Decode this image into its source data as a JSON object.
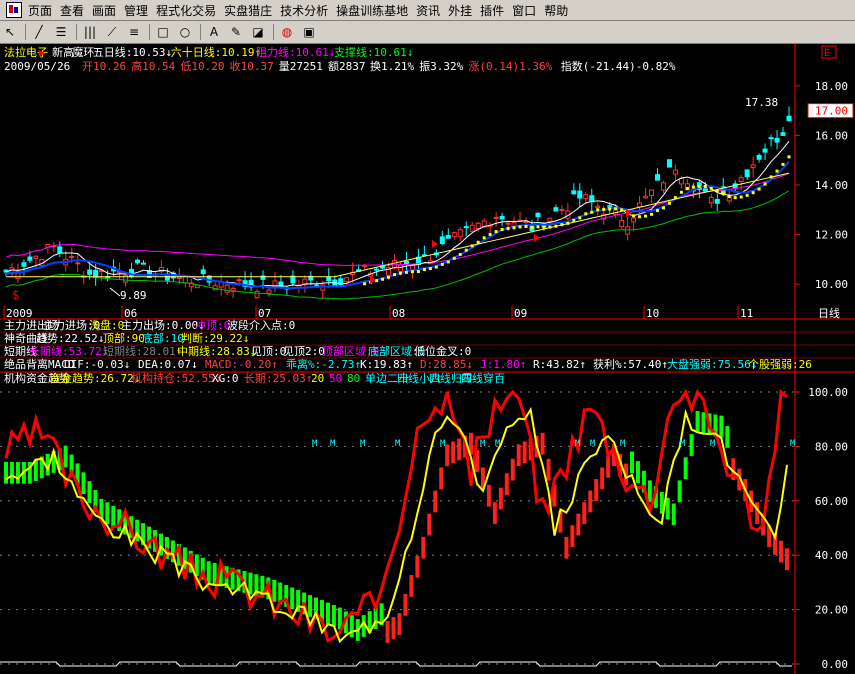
{
  "menu": [
    "页面",
    "查看",
    "画面",
    "管理",
    "程式化交易",
    "实盘猎庄",
    "技术分析",
    "操盘训练基地",
    "资讯",
    "外挂",
    "插件",
    "窗口",
    "帮助"
  ],
  "toolbar_icons": [
    "cursor-icon",
    "line-icon",
    "indicator-icon",
    "grid-icon",
    "fan-icon",
    "channel-icon",
    "rect-icon",
    "ellipse-icon",
    "text-icon",
    "brush-icon",
    "eraser-icon",
    "palette-icon",
    "save-icon"
  ],
  "header": {
    "row1": [
      {
        "t": "法拉电子",
        "c": "#ffff00"
      },
      {
        "t": "▶",
        "c": "#ff0000"
      },
      {
        "t": "新高",
        "c": "#ffffff"
      },
      {
        "t": "魔环",
        "c": "#ffffff"
      },
      {
        "t": "五日线:10.53↓",
        "c": "#ffffff"
      },
      {
        "t": "六十日线:10.19↑",
        "c": "#ffff00"
      },
      {
        "t": "阻力线:10.61↓",
        "c": "#ff00ff"
      },
      {
        "t": "支撑线:10.61↓",
        "c": "#00ff00"
      }
    ],
    "row2": [
      {
        "t": "2009/05/26",
        "c": "#ffffff"
      },
      {
        "t": "开10.26",
        "c": "#ff4040"
      },
      {
        "t": "高10.54",
        "c": "#ff4040"
      },
      {
        "t": "低10.20",
        "c": "#ff4040"
      },
      {
        "t": "收10.37",
        "c": "#ff4040"
      },
      {
        "t": "量27251",
        "c": "#ffffff"
      },
      {
        "t": "额2837",
        "c": "#ffffff"
      },
      {
        "t": "换1.21%",
        "c": "#ffffff"
      },
      {
        "t": "振3.32%",
        "c": "#ffffff"
      },
      {
        "t": "涨(0.14)1.36%",
        "c": "#ff4040"
      },
      {
        "t": "指数(-21.44)-0.82%",
        "c": "#ffffff"
      }
    ]
  },
  "price_axis": [
    "18.00",
    "16.00",
    "14.00",
    "12.00",
    "10.00"
  ],
  "current_price": "17.00",
  "low_label": "9.89",
  "high_label": "17.38",
  "date_axis": [
    "2009",
    "06",
    "07",
    "08",
    "09",
    "10",
    "11"
  ],
  "date_unit": "日线",
  "indicator_rows": [
    [
      {
        "t": "主力进出场",
        "c": "#ffffff"
      },
      {
        "t": "主力进场:0",
        "c": "#ffffff"
      },
      {
        "t": "洗盘:0",
        "c": "#ffff00"
      },
      {
        "t": "主力出场:0.00↓",
        "c": "#ffffff"
      },
      {
        "t": "冲顶:0",
        "c": "#ff00ff"
      },
      {
        "t": "波段介入点:0",
        "c": "#ffffff"
      }
    ],
    [
      {
        "t": "神奇曲线",
        "c": "#ffffff"
      },
      {
        "t": "趋势:22.52↓",
        "c": "#ffffff"
      },
      {
        "t": "顶部:90",
        "c": "#ffff00"
      },
      {
        "t": "底部:10",
        "c": "#00ffff"
      },
      {
        "t": "判断:29.22↓",
        "c": "#ffff00"
      }
    ],
    [
      {
        "t": "短期线",
        "c": "#ffffff"
      },
      {
        "t": "长期线:53.72↓",
        "c": "#ff00ff"
      },
      {
        "t": "短期线:28.01↑",
        "c": "#808080"
      },
      {
        "t": "中期线:28.83↓",
        "c": "#ffff00"
      },
      {
        "t": "见顶:0",
        "c": "#ffffff"
      },
      {
        "t": "见顶2:0",
        "c": "#ffffff"
      },
      {
        "t": "顶部区域:0",
        "c": "#ff00ff"
      },
      {
        "t": "底部区域:0",
        "c": "#00ffff"
      },
      {
        "t": "低位金叉:0",
        "c": "#ffffff"
      }
    ],
    [
      {
        "t": "绝品背离MACD",
        "c": "#ffffff"
      },
      {
        "t": "DIF:-0.03↓",
        "c": "#ffffff"
      },
      {
        "t": "DEA:0.07↓",
        "c": "#ffffff"
      },
      {
        "t": "MACD:-0.20↑",
        "c": "#ff4040"
      },
      {
        "t": "乖离%:-2.73↑",
        "c": "#00ffff"
      },
      {
        "t": "K:19.83↑",
        "c": "#ffffff"
      },
      {
        "t": "D:28.85↓",
        "c": "#ff4040"
      },
      {
        "t": "J:1.80↑",
        "c": "#ff00ff"
      },
      {
        "t": "R:43.82↑",
        "c": "#ffffff"
      },
      {
        "t": "获利%:57.40↑",
        "c": "#ffffff"
      },
      {
        "t": "大盘强弱:75.56↓",
        "c": "#00ffff"
      },
      {
        "t": "个股强弱:26",
        "c": "#ffff00"
      }
    ],
    [
      {
        "t": "机构资金趋势",
        "c": "#ffffff"
      },
      {
        "t": "资金趋势:26.72↓",
        "c": "#ffff00"
      },
      {
        "t": "机构持仓:52.55↓",
        "c": "#ff4040"
      },
      {
        "t": "XG:0",
        "c": "#ffffff"
      },
      {
        "t": "长期:25.03↑",
        "c": "#ff4040"
      },
      {
        "t": "20",
        "c": "#ffff00"
      },
      {
        "t": "50",
        "c": "#ff00ff"
      },
      {
        "t": "80",
        "c": "#00ff00"
      },
      {
        "t": "单边二十",
        "c": "#00ffff"
      },
      {
        "t": "四线小六",
        "c": "#00ffff"
      },
      {
        "t": "四线归零",
        "c": "#00ffff"
      },
      {
        "t": "四线穿百",
        "c": "#00ffff"
      }
    ]
  ],
  "lower_axis": [
    "100.00",
    "80.00",
    "60.00",
    "40.00",
    "20.00",
    "0.00"
  ],
  "chart_data": {
    "type": "candlestick",
    "price_range": [
      9.0,
      18.8
    ],
    "indicator_range": [
      0,
      100
    ],
    "price_ticks": [
      18,
      16,
      14,
      12,
      10
    ],
    "indicator_ticks": [
      100,
      80,
      60,
      40,
      20,
      0
    ],
    "low_annotation": 9.89,
    "high_annotation": 17.38,
    "current": 17.0
  }
}
